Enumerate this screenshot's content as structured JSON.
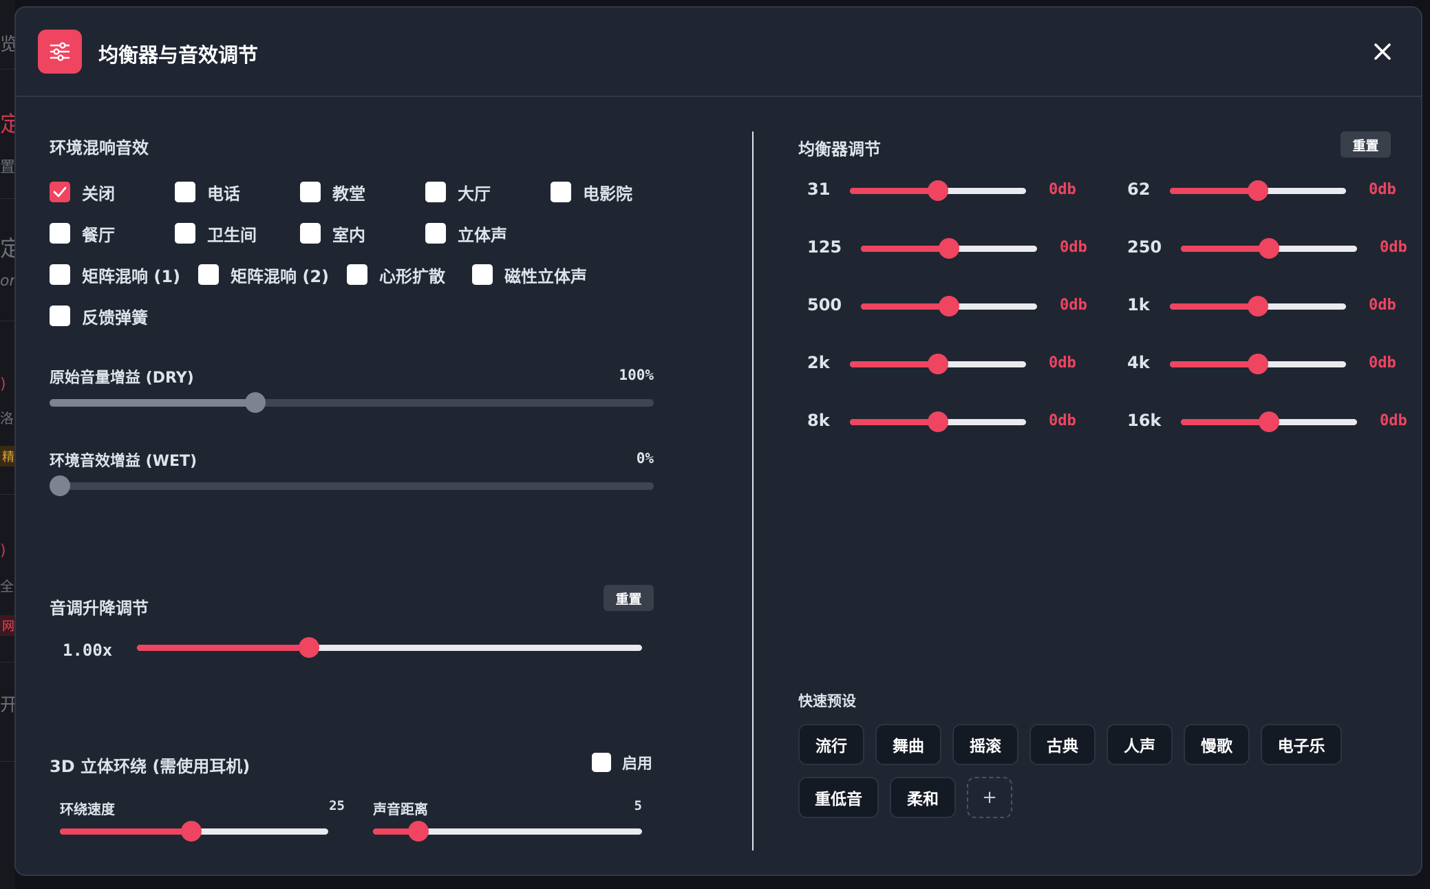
{
  "background": {
    "ghost_texts": [
      "览",
      "定义",
      "置",
      "定",
      "or",
      "洛",
      "精彩",
      "全",
      "网易",
      "开"
    ]
  },
  "modal": {
    "title": "均衡器与音效调节",
    "icon": "sliders-icon",
    "close_icon": "close-icon"
  },
  "reverb": {
    "title": "环境混响音效",
    "options": [
      {
        "label": "关闭",
        "checked": true
      },
      {
        "label": "电话",
        "checked": false
      },
      {
        "label": "教堂",
        "checked": false
      },
      {
        "label": "大厅",
        "checked": false
      },
      {
        "label": "电影院",
        "checked": false
      },
      {
        "label": "餐厅",
        "checked": false
      },
      {
        "label": "卫生间",
        "checked": false
      },
      {
        "label": "室内",
        "checked": false
      },
      {
        "label": "立体声",
        "checked": false
      },
      {
        "label": "矩阵混响 (1)",
        "checked": false
      },
      {
        "label": "矩阵混响 (2)",
        "checked": false
      },
      {
        "label": "心形扩散",
        "checked": false
      },
      {
        "label": "磁性立体声",
        "checked": false
      },
      {
        "label": "反馈弹簧",
        "checked": false
      }
    ],
    "dry_label": "原始音量增益 (DRY)",
    "dry_value": "100%",
    "dry_level": 0.34,
    "wet_label": "环境音效增益 (WET)",
    "wet_value": "0%",
    "wet_level": 0.0
  },
  "pitch": {
    "title": "音调升降调节",
    "reset_label": "重置",
    "value": "1.00x",
    "level": 0.34
  },
  "surround": {
    "title": "3D 立体环绕 (需使用耳机)",
    "enable_label": "启用",
    "enabled": false,
    "speed_label": "环绕速度",
    "speed_value": "25",
    "speed_level": 0.49,
    "distance_label": "声音距离",
    "distance_value": "5",
    "distance_level": 0.17
  },
  "equalizer": {
    "title": "均衡器调节",
    "reset_label": "重置",
    "bands": [
      {
        "freq": "31",
        "gain": "0db",
        "level": 0.5
      },
      {
        "freq": "62",
        "gain": "0db",
        "level": 0.5
      },
      {
        "freq": "125",
        "gain": "0db",
        "level": 0.5
      },
      {
        "freq": "250",
        "gain": "0db",
        "level": 0.5
      },
      {
        "freq": "500",
        "gain": "0db",
        "level": 0.5
      },
      {
        "freq": "1k",
        "gain": "0db",
        "level": 0.5
      },
      {
        "freq": "2k",
        "gain": "0db",
        "level": 0.5
      },
      {
        "freq": "4k",
        "gain": "0db",
        "level": 0.5
      },
      {
        "freq": "8k",
        "gain": "0db",
        "level": 0.5
      },
      {
        "freq": "16k",
        "gain": "0db",
        "level": 0.5
      }
    ]
  },
  "presets": {
    "title": "快速预设",
    "items": [
      "流行",
      "舞曲",
      "摇滚",
      "古典",
      "人声",
      "慢歌",
      "电子乐",
      "重低音",
      "柔和"
    ],
    "add_label": "+"
  },
  "colors": {
    "accent": "#ef4560",
    "modal_bg": "#1f2632",
    "page_bg": "#111318"
  }
}
